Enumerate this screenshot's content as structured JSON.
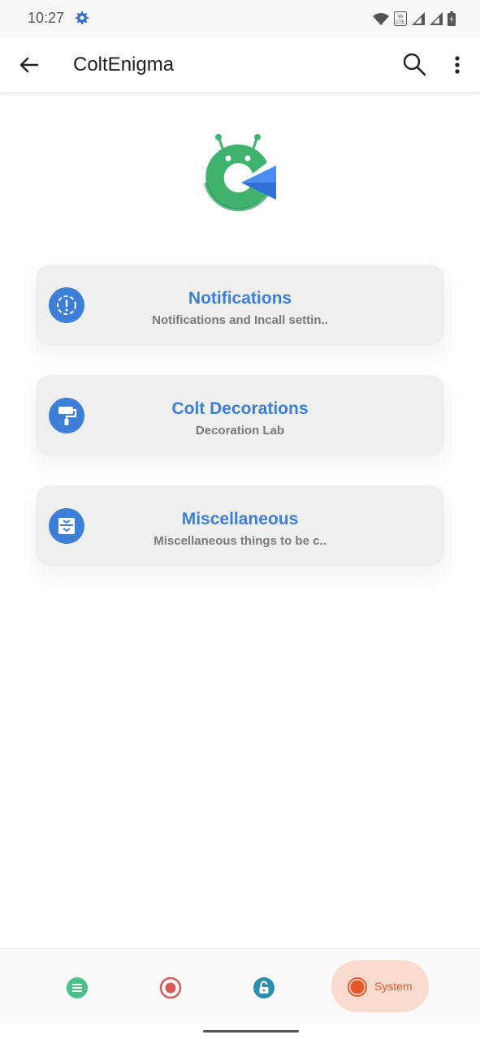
{
  "status_bar": {
    "time": "10:27",
    "icons": [
      "settings-gear-icon",
      "wifi-icon",
      "volte-icon",
      "signal-icon",
      "signal-icon",
      "battery-icon"
    ]
  },
  "app_bar": {
    "title": "ColtEnigma",
    "back_icon": "arrow-left-icon",
    "search_icon": "search-icon",
    "menu_icon": "more-vertical-icon"
  },
  "logo": {
    "name": "coltenigma-logo",
    "colors": {
      "green": "#3fb36e",
      "blue": "#2f6fd6"
    }
  },
  "cards": [
    {
      "title": "Notifications",
      "subtitle": "Notifications and Incall settin..",
      "icon": "alert-circle-icon"
    },
    {
      "title": "Colt Decorations",
      "subtitle": "Decoration Lab",
      "icon": "paint-roller-icon"
    },
    {
      "title": "Miscellaneous",
      "subtitle": "Miscellaneous things to be c..",
      "icon": "archive-box-icon"
    }
  ],
  "bottom_nav": {
    "items": [
      {
        "icon": "list-icon",
        "color": "#4cc08a"
      },
      {
        "icon": "record-icon",
        "color": "#d65a5a"
      },
      {
        "icon": "lock-icon",
        "color": "#2b8fb0"
      },
      {
        "icon": "system-icon",
        "label": "System",
        "color": "#e25a2c",
        "active": true
      }
    ]
  },
  "colors": {
    "accent": "#3d7fd6",
    "card_bg": "#efefef",
    "active_nav_bg": "#fadbd0"
  }
}
